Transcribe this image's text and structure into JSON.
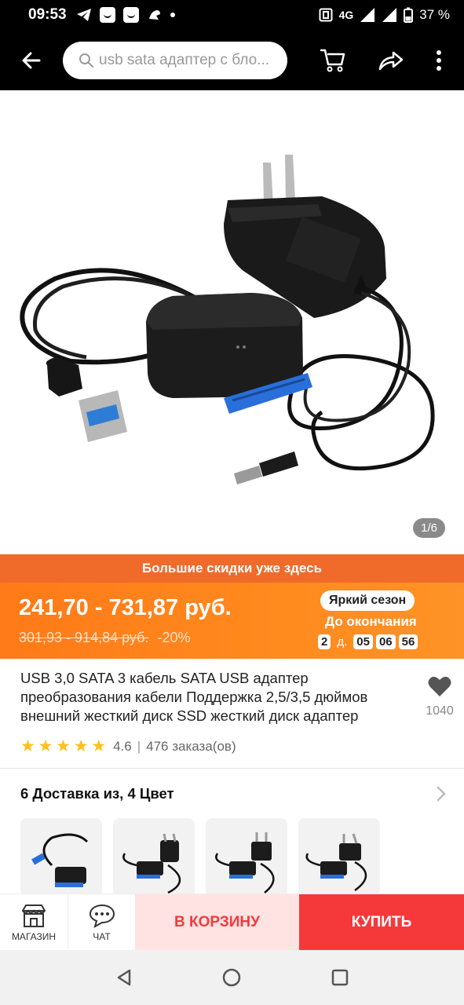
{
  "status_bar": {
    "time": "09:53",
    "network": "4G",
    "battery": "37 %"
  },
  "app_bar": {
    "search_placeholder": "usb sata адаптер с бло..."
  },
  "gallery": {
    "counter": "1/6"
  },
  "promo": {
    "banner": "Большие скидки уже здесь",
    "price": "241,70 - 731,87 руб.",
    "old_price": "301,93 - 914,84 руб.",
    "discount": "-20%",
    "season_label": "Яркий сезон",
    "until_label": "До окончания",
    "days": "2",
    "days_unit": "д.",
    "hours": "05",
    "minutes": "06",
    "seconds": "56"
  },
  "product": {
    "title": "USB 3,0 SATA 3 кабель SATA USB адаптер преобразования кабели Поддержка 2,5/3,5 дюймов внешний жесткий диск SSD жесткий диск адаптер",
    "wishlist_count": "1040",
    "rating": "4.6",
    "rating_stars": 4.6,
    "orders": "476 заказа(ов)"
  },
  "variants": {
    "title": "6 Доставка из, 4 Цвет"
  },
  "bottom_bar": {
    "store_label": "МАГАЗИН",
    "chat_label": "ЧАТ",
    "cart_label": "В КОРЗИНУ",
    "buy_label": "КУПИТЬ"
  },
  "colors": {
    "accent_red": "#f5393b",
    "promo_orange": "#ff7a18",
    "star_yellow": "#ffc01e"
  }
}
